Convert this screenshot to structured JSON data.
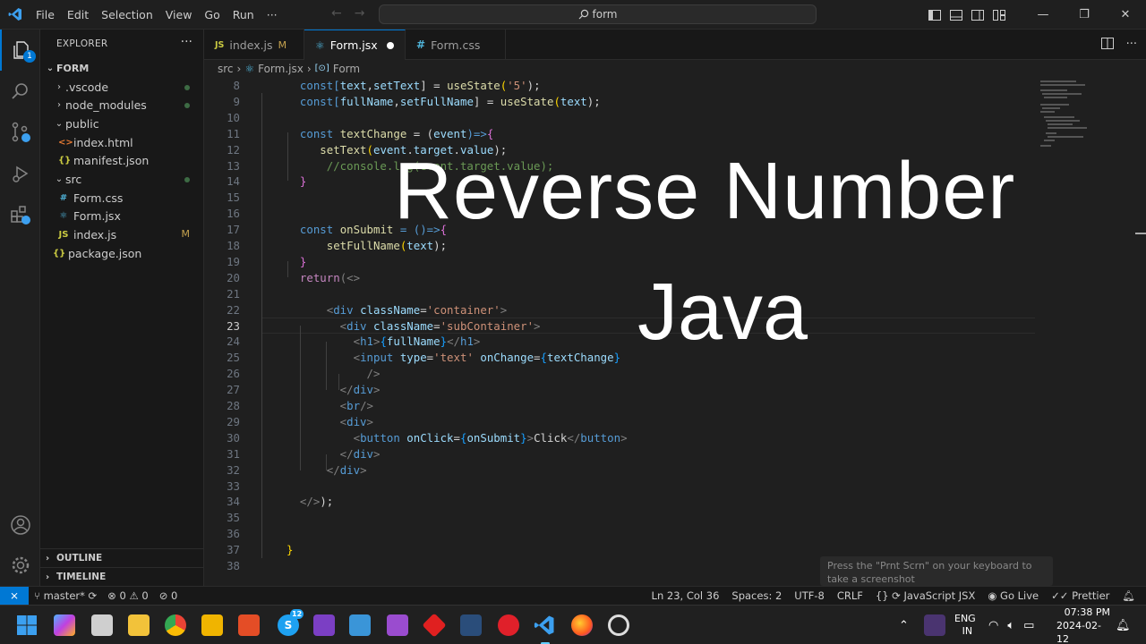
{
  "menu": [
    "File",
    "Edit",
    "Selection",
    "View",
    "Go",
    "Run",
    "···"
  ],
  "search": {
    "text": "form"
  },
  "explorer": {
    "header": "EXPLORER",
    "root": "FORM",
    "items": [
      {
        "label": ".vscode",
        "kind": "folder",
        "depth": 1,
        "open": false,
        "dot": true
      },
      {
        "label": "node_modules",
        "kind": "folder",
        "depth": 1,
        "open": false,
        "dot": true
      },
      {
        "label": "public",
        "kind": "folder",
        "depth": 1,
        "open": true
      },
      {
        "label": "index.html",
        "kind": "html",
        "depth": 2
      },
      {
        "label": "manifest.json",
        "kind": "json",
        "depth": 2
      },
      {
        "label": "src",
        "kind": "folder",
        "depth": 1,
        "open": true,
        "dot": true
      },
      {
        "label": "Form.css",
        "kind": "css",
        "depth": 2
      },
      {
        "label": "Form.jsx",
        "kind": "jsx",
        "depth": 2
      },
      {
        "label": "index.js",
        "kind": "js",
        "depth": 2,
        "mod": "M"
      },
      {
        "label": "package.json",
        "kind": "json",
        "depth": 1
      }
    ],
    "outline": "OUTLINE",
    "timeline": "TIMELINE"
  },
  "tabs": [
    {
      "label": "index.js",
      "icon": "JS",
      "mod": "M"
    },
    {
      "label": "Form.jsx",
      "icon": "⚛",
      "active": true,
      "dirty": true
    },
    {
      "label": "Form.css",
      "icon": "#"
    }
  ],
  "breadcrumb": {
    "a": "src",
    "b": "Form.jsx",
    "c": "Form"
  },
  "code": {
    "current_line": 23,
    "first_line": 8,
    "lines": [
      [
        [
          "  const[",
          "kw"
        ],
        [
          "text",
          "var"
        ],
        [
          ",",
          "pl"
        ],
        [
          "setText",
          "var"
        ],
        [
          "] = ",
          "pl"
        ],
        [
          "useState",
          "fn"
        ],
        [
          "(",
          "br1"
        ],
        [
          "'5'",
          "str"
        ],
        [
          ");",
          "pl"
        ]
      ],
      [
        [
          "  const[",
          "kw"
        ],
        [
          "fullName",
          "var"
        ],
        [
          ",",
          "pl"
        ],
        [
          "setFullName",
          "var"
        ],
        [
          "] = ",
          "pl"
        ],
        [
          "useState",
          "fn"
        ],
        [
          "(",
          "br1"
        ],
        [
          "text",
          "var"
        ],
        [
          ");",
          "pl"
        ]
      ],
      [],
      [
        [
          "  const ",
          "kw"
        ],
        [
          "textChange",
          "fn"
        ],
        [
          " = (",
          "pl"
        ],
        [
          "event",
          "var"
        ],
        [
          ")=>",
          "kw"
        ],
        [
          "{",
          "br2"
        ]
      ],
      [
        [
          "     setText",
          "fn"
        ],
        [
          "(",
          "br1"
        ],
        [
          "event",
          "var"
        ],
        [
          ".",
          "pl"
        ],
        [
          "target",
          "var"
        ],
        [
          ".",
          "pl"
        ],
        [
          "value",
          "var"
        ],
        [
          ");",
          "pl"
        ]
      ],
      [
        [
          "      //console.log(event.target.value);",
          "cm"
        ]
      ],
      [
        [
          "  }",
          "br2"
        ]
      ],
      [],
      [],
      [
        [
          "  const ",
          "kw"
        ],
        [
          "onSubmit",
          "fn"
        ],
        [
          " = ()=>",
          "kw"
        ],
        [
          "{",
          "br2"
        ]
      ],
      [
        [
          "      setFullName",
          "fn"
        ],
        [
          "(",
          "br1"
        ],
        [
          "text",
          "var"
        ],
        [
          ");",
          "pl"
        ]
      ],
      [
        [
          "  }",
          "br2"
        ]
      ],
      [
        [
          "  return",
          "kw2"
        ],
        [
          "(<>",
          "ang"
        ]
      ],
      [],
      [
        [
          "      <",
          "ang"
        ],
        [
          "div ",
          "tag"
        ],
        [
          "className",
          "attr"
        ],
        [
          "=",
          "pl"
        ],
        [
          "'container'",
          "str"
        ],
        [
          ">",
          "ang"
        ]
      ],
      [
        [
          "        <",
          "ang"
        ],
        [
          "div ",
          "tag"
        ],
        [
          "className",
          "attr"
        ],
        [
          "=",
          "pl"
        ],
        [
          "'subContainer'",
          "str"
        ],
        [
          ">",
          "ang"
        ]
      ],
      [
        [
          "          <",
          "ang"
        ],
        [
          "h1",
          "tag"
        ],
        [
          ">",
          "ang"
        ],
        [
          "{",
          "br3"
        ],
        [
          "fullName",
          "var"
        ],
        [
          "}",
          "br3"
        ],
        [
          "</",
          "ang"
        ],
        [
          "h1",
          "tag"
        ],
        [
          ">",
          "ang"
        ]
      ],
      [
        [
          "          <",
          "ang"
        ],
        [
          "input ",
          "tag"
        ],
        [
          "type",
          "attr"
        ],
        [
          "=",
          "pl"
        ],
        [
          "'text' ",
          "str"
        ],
        [
          "onChange",
          "attr"
        ],
        [
          "=",
          "pl"
        ],
        [
          "{",
          "br3"
        ],
        [
          "textChange",
          "var"
        ],
        [
          "}",
          "br3"
        ]
      ],
      [
        [
          "            />",
          "ang"
        ]
      ],
      [
        [
          "        </",
          "ang"
        ],
        [
          "div",
          "tag"
        ],
        [
          ">",
          "ang"
        ]
      ],
      [
        [
          "        <",
          "ang"
        ],
        [
          "br",
          "tag"
        ],
        [
          "/>",
          "ang"
        ]
      ],
      [
        [
          "        <",
          "ang"
        ],
        [
          "div",
          "tag"
        ],
        [
          ">",
          "ang"
        ]
      ],
      [
        [
          "          <",
          "ang"
        ],
        [
          "button ",
          "tag"
        ],
        [
          "onClick",
          "attr"
        ],
        [
          "=",
          "pl"
        ],
        [
          "{",
          "br3"
        ],
        [
          "onSubmit",
          "var"
        ],
        [
          "}",
          "br3"
        ],
        [
          ">",
          "ang"
        ],
        [
          "Click",
          "pl"
        ],
        [
          "</",
          "ang"
        ],
        [
          "button",
          "tag"
        ],
        [
          ">",
          "ang"
        ]
      ],
      [
        [
          "        </",
          "ang"
        ],
        [
          "div",
          "tag"
        ],
        [
          ">",
          "ang"
        ]
      ],
      [
        [
          "      </",
          "ang"
        ],
        [
          "div",
          "tag"
        ],
        [
          ">",
          "ang"
        ]
      ],
      [],
      [
        [
          "  </>",
          "ang"
        ],
        [
          ");",
          "pl"
        ]
      ],
      [],
      [],
      [
        [
          "}",
          "br1"
        ]
      ],
      []
    ]
  },
  "overlay": {
    "title": "Reverse Number",
    "subtitle": "Java"
  },
  "toast": "Press the \"Prnt Scrn\" on your keyboard to take a screenshot",
  "status": {
    "branch": "master*",
    "errors": "0",
    "warnings": "0",
    "ports": "0",
    "position": "Ln 23, Col 36",
    "spaces": "Spaces: 2",
    "encoding": "UTF-8",
    "eol": "CRLF",
    "language": "JavaScript JSX",
    "golive": "Go Live",
    "prettier": "Prettier"
  },
  "taskbar": {
    "lang1": "ENG",
    "lang2": "IN",
    "time": "07:38 PM",
    "date": "2024-02-12",
    "notif": "12"
  },
  "colors": {
    "accent": "#0078d4",
    "editor_bg": "#1f1f1f",
    "sidebar_bg": "#181818"
  }
}
